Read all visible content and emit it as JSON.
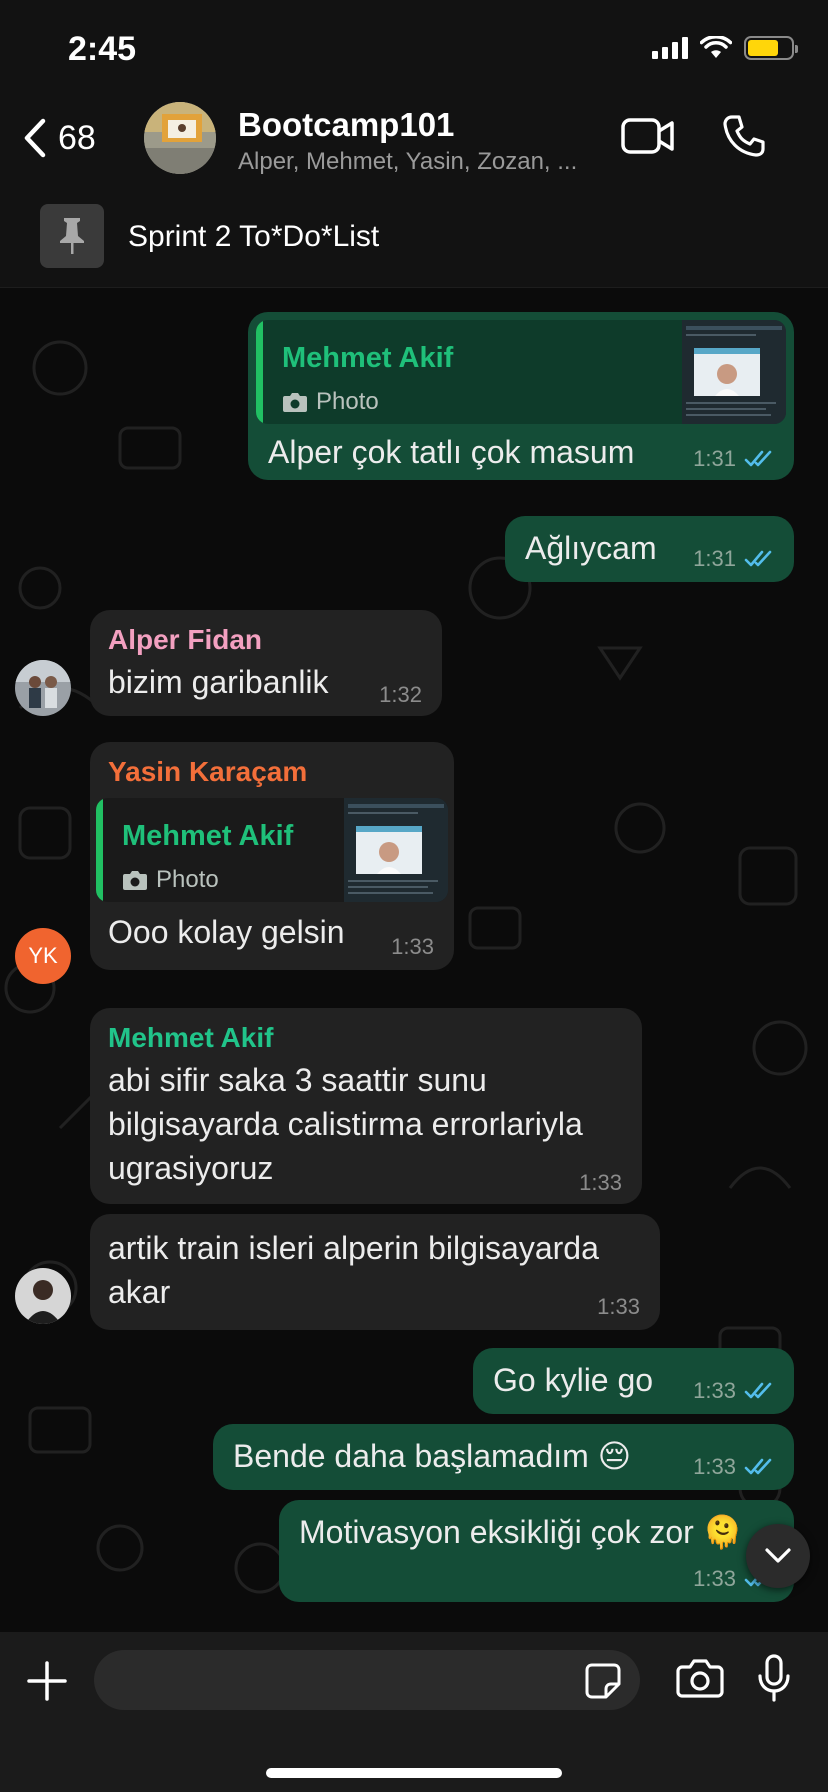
{
  "status_bar": {
    "time": "2:45"
  },
  "header": {
    "back_count": "68",
    "title": "Bootcamp101",
    "subtitle": "Alper, Mehmet, Yasin, Zozan, ..."
  },
  "pinned": {
    "text": "Sprint 2 To*Do*List"
  },
  "messages": [
    {
      "quote_name": "Mehmet Akif",
      "quote_type": "Photo",
      "text": "Alper çok tatlı çok masum",
      "time": "1:31"
    },
    {
      "text": "Ağlıycam",
      "time": "1:31"
    },
    {
      "sender": "Alper Fidan",
      "text": "bizim garibanlik",
      "time": "1:32"
    },
    {
      "sender": "Yasin Karaçam",
      "quote_name": "Mehmet Akif",
      "quote_type": "Photo",
      "text": "Ooo kolay gelsin",
      "time": "1:33",
      "avatar_initials": "YK"
    },
    {
      "sender": "Mehmet Akif",
      "line1": "abi sifir saka 3 saattir sunu",
      "line2": "bilgisayarda calistirma errorlariyla",
      "line3": "ugrasiyoruz",
      "time": "1:33"
    },
    {
      "line1": "artik train isleri alperin bilgisayarda",
      "line2": "akar",
      "time": "1:33"
    },
    {
      "text": "Go kylie go",
      "time": "1:33"
    },
    {
      "text": "Bende daha başlamadım 😔",
      "time": "1:33"
    },
    {
      "text": "Motivasyon eksikliği çok zor 🫠",
      "time": "1:33"
    }
  ],
  "colors": {
    "outgoing_bubble": "#144d37",
    "incoming_bubble": "#222222",
    "sender_alper": "#f3a0c0",
    "sender_yasin": "#f36f3a",
    "sender_mehmet": "#21c48a",
    "read_ticks": "#53bdeb"
  }
}
